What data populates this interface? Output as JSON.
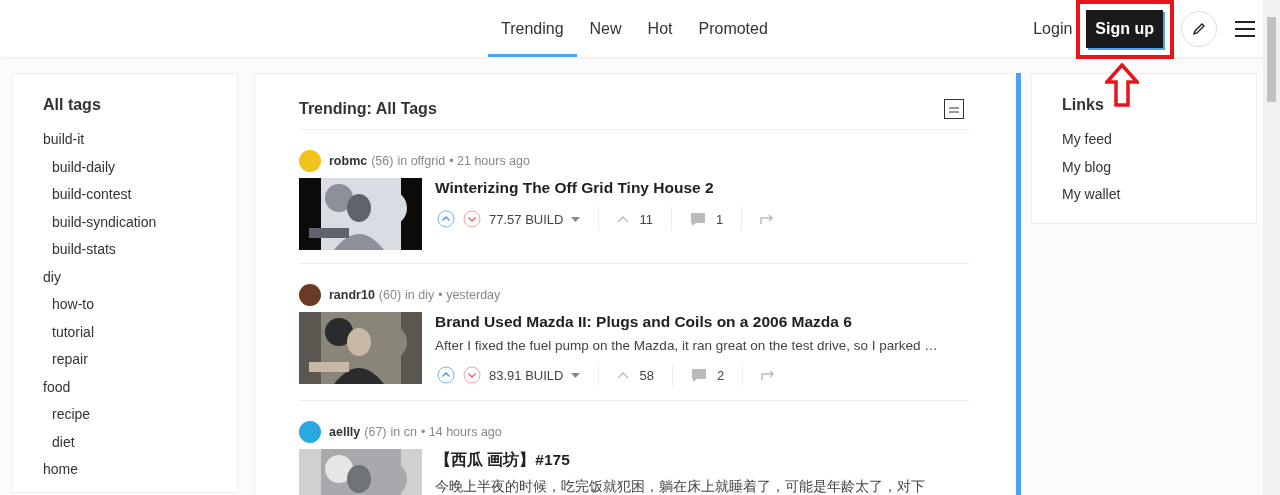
{
  "nav": {
    "tabs": [
      {
        "label": "Trending",
        "selected": true
      },
      {
        "label": "New",
        "selected": false
      },
      {
        "label": "Hot",
        "selected": false
      },
      {
        "label": "Promoted",
        "selected": false
      }
    ],
    "login": "Login",
    "signup": {
      "label": "Sign up",
      "highlighted": true
    }
  },
  "tags": {
    "title": "All tags",
    "items": [
      {
        "label": "build-it",
        "children": [
          {
            "label": "build-daily"
          },
          {
            "label": "build-contest"
          },
          {
            "label": "build-syndication"
          },
          {
            "label": "build-stats"
          }
        ]
      },
      {
        "label": "diy",
        "children": [
          {
            "label": "how-to"
          },
          {
            "label": "tutorial"
          },
          {
            "label": "repair"
          }
        ]
      },
      {
        "label": "food",
        "children": [
          {
            "label": "recipe"
          },
          {
            "label": "diet"
          }
        ]
      },
      {
        "label": "home"
      }
    ]
  },
  "feed": {
    "title": "Trending: All Tags",
    "posts": [
      {
        "author": "robmc",
        "reputation": "(56)",
        "community": "in offgrid",
        "time": "• 21 hours ago",
        "title": "Winterizing The Off Grid Tiny House 2",
        "payout": "77.57 BUILD",
        "votes": "11",
        "comments": "1",
        "color": "#f2c31b"
      },
      {
        "author": "randr10",
        "reputation": "(60)",
        "community": "in diy",
        "time": "• yesterday",
        "title": "Brand Used Mazda II: Plugs and Coils on a 2006 Mazda 6",
        "excerpt": "After I fixed the fuel pump on the Mazda, it ran great on the test drive, so I parked …",
        "payout": "83.91 BUILD",
        "votes": "58",
        "comments": "2",
        "color": "#6b3a22"
      },
      {
        "author": "aellly",
        "reputation": "(67)",
        "community": "in cn",
        "time": "• 14 hours ago",
        "title": "【西瓜 画坊】#175",
        "excerpt": "今晚上半夜的时候，吃完饭就犯困，躺在床上就睡着了，可能是年龄太了，对下",
        "color": "#2aa8e0"
      }
    ]
  },
  "links": {
    "title": "Links",
    "items": [
      "My feed",
      "My blog",
      "My wallet"
    ]
  }
}
